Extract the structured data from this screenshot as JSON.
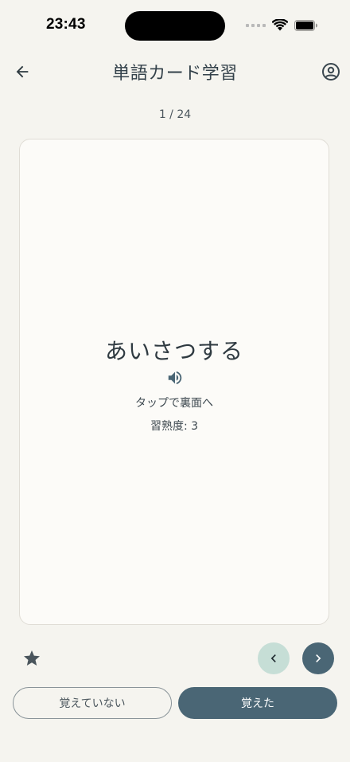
{
  "status_bar": {
    "time": "23:43",
    "icons": [
      "signal-dots-icon",
      "wifi-icon",
      "battery-icon"
    ]
  },
  "header": {
    "title": "単語カード学習",
    "back_icon": "arrow-left-icon",
    "account_icon": "account-circle-icon"
  },
  "progress": {
    "counter_text": "1 / 24"
  },
  "card": {
    "word": "あいさつする",
    "speaker_icon": "speaker-icon",
    "hint": "タップで裏面へ",
    "mastery": "習熟度: 3"
  },
  "controls": {
    "star_icon": "star-icon",
    "prev_icon": "chevron-left-icon",
    "next_icon": "chevron-right-icon",
    "unknown_label": "覚えていない",
    "known_label": "覚えた"
  },
  "colors": {
    "background": "#f5f4ef",
    "card": "#fcfbf8",
    "primary": "#4a6675",
    "prev_button": "#c6ded6"
  }
}
